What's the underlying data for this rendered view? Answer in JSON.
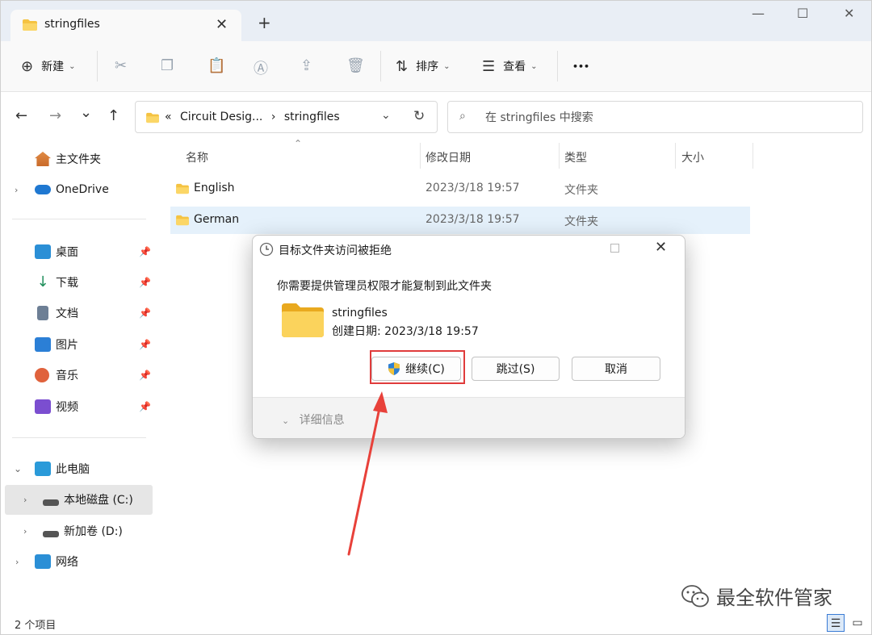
{
  "tab": {
    "title": "stringfiles",
    "close_glyph": "✕",
    "new_tab_glyph": "+"
  },
  "window_controls": {
    "minimize": "—",
    "maximize": "☐",
    "close": "✕"
  },
  "toolbar": {
    "new_label": "新建",
    "sort_label": "排序",
    "view_label": "查看",
    "more_glyph": "•••",
    "icons": [
      "cut-icon",
      "copy-icon",
      "paste-icon",
      "rename-icon",
      "share-icon",
      "delete-icon"
    ]
  },
  "nav": {
    "back": "←",
    "forward": "→",
    "recent": "⌄",
    "up": "↑"
  },
  "address": {
    "prefix": "«",
    "path": [
      "Circuit Desig...",
      "stringfiles"
    ],
    "separator": "›"
  },
  "search": {
    "placeholder": "在 stringfiles 中搜索"
  },
  "sidebar": {
    "home": "主文件夹",
    "onedrive": "OneDrive",
    "quick": [
      {
        "label": "桌面",
        "icon": "desktop-icon",
        "color": "#2b8fd6"
      },
      {
        "label": "下载",
        "icon": "download-icon",
        "color": "#1e8e5a"
      },
      {
        "label": "文档",
        "icon": "documents-icon",
        "color": "#6d7f95"
      },
      {
        "label": "图片",
        "icon": "pictures-icon",
        "color": "#2b7fd6"
      },
      {
        "label": "音乐",
        "icon": "music-icon",
        "color": "#e0623c"
      },
      {
        "label": "视频",
        "icon": "videos-icon",
        "color": "#7b4ed0"
      }
    ],
    "this_pc": "此电脑",
    "drives": [
      "本地磁盘 (C:)",
      "新加卷 (D:)"
    ],
    "network": "网络"
  },
  "columns": {
    "name": "名称",
    "modified": "修改日期",
    "type": "类型",
    "size": "大小"
  },
  "files": [
    {
      "name": "English",
      "modified": "2023/3/18 19:57",
      "type": "文件夹"
    },
    {
      "name": "German",
      "modified": "2023/3/18 19:57",
      "type": "文件夹"
    }
  ],
  "status": {
    "count": "2 个项目"
  },
  "watermark": "最全软件管家",
  "dialog": {
    "title": "目标文件夹访问被拒绝",
    "message": "你需要提供管理员权限才能复制到此文件夹",
    "folder_name": "stringfiles",
    "created": "创建日期: 2023/3/18 19:57",
    "continue_label": "继续(C)",
    "skip_label": "跳过(S)",
    "cancel_label": "取消",
    "details_label": "详细信息"
  },
  "colors": {
    "highlight": "#e03b3b",
    "selected_row": "#e5f1fb",
    "folder": "#f5c342"
  }
}
